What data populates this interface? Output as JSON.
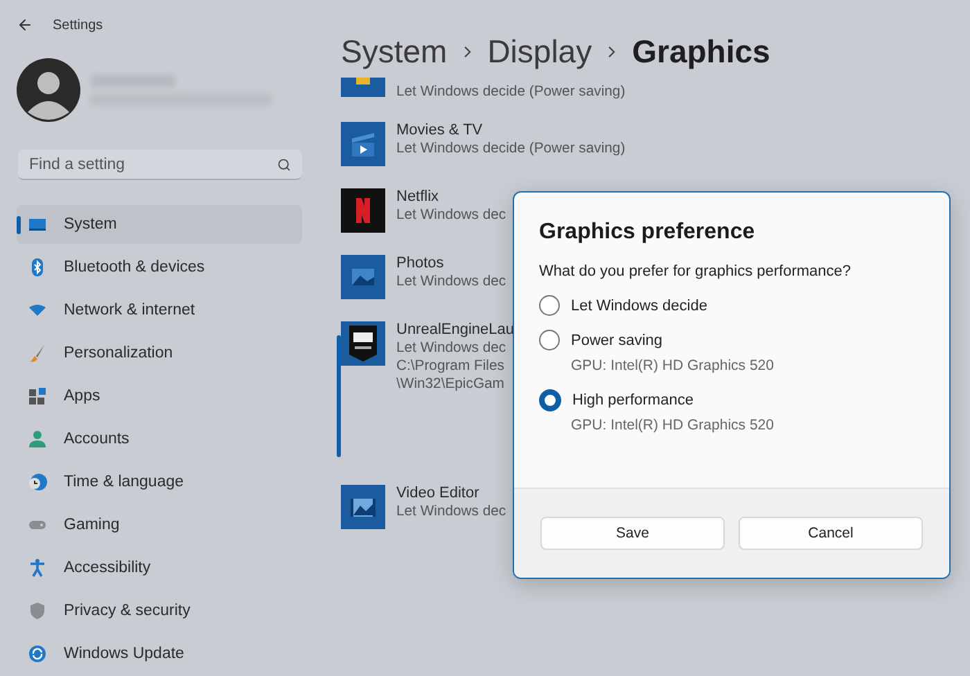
{
  "window": {
    "title": "Settings"
  },
  "search": {
    "placeholder": "Find a setting"
  },
  "nav": [
    {
      "label": "System",
      "kind": "system",
      "selected": true
    },
    {
      "label": "Bluetooth & devices",
      "kind": "bluetooth",
      "selected": false
    },
    {
      "label": "Network & internet",
      "kind": "network",
      "selected": false
    },
    {
      "label": "Personalization",
      "kind": "brush",
      "selected": false
    },
    {
      "label": "Apps",
      "kind": "apps",
      "selected": false
    },
    {
      "label": "Accounts",
      "kind": "accounts",
      "selected": false
    },
    {
      "label": "Time & language",
      "kind": "time",
      "selected": false
    },
    {
      "label": "Gaming",
      "kind": "gaming",
      "selected": false
    },
    {
      "label": "Accessibility",
      "kind": "accessibility",
      "selected": false
    },
    {
      "label": "Privacy & security",
      "kind": "privacy",
      "selected": false
    },
    {
      "label": "Windows Update",
      "kind": "update",
      "selected": false
    }
  ],
  "breadcrumb": [
    "System",
    "Display",
    "Graphics"
  ],
  "apps": [
    {
      "kind": "partial",
      "detail": "Let Windows decide (Power saving)",
      "expanded": false
    },
    {
      "kind": "movies",
      "name": "Movies & TV",
      "detail": "Let Windows decide (Power saving)",
      "expanded": false
    },
    {
      "kind": "netflix",
      "name": "Netflix",
      "detail": "Let Windows dec",
      "expanded": false
    },
    {
      "kind": "photos",
      "name": "Photos",
      "detail": "Let Windows dec",
      "expanded": false
    },
    {
      "kind": "epic",
      "name": "UnrealEngineLau",
      "detail": "Let Windows dec",
      "path": [
        "C:\\Program Files",
        "\\Win32\\EpicGam"
      ],
      "expanded": true
    },
    {
      "kind": "video",
      "name": "Video Editor",
      "detail": "Let Windows dec",
      "expanded": false
    }
  ],
  "dialog": {
    "title": "Graphics preference",
    "question": "What do you prefer for graphics performance?",
    "options": [
      {
        "label": "Let Windows decide",
        "selected": false
      },
      {
        "label": "Power saving",
        "gpu": "GPU: Intel(R) HD Graphics 520",
        "selected": false
      },
      {
        "label": "High performance",
        "gpu": "GPU: Intel(R) HD Graphics 520",
        "selected": true
      }
    ],
    "buttons": [
      "Save",
      "Cancel"
    ]
  }
}
